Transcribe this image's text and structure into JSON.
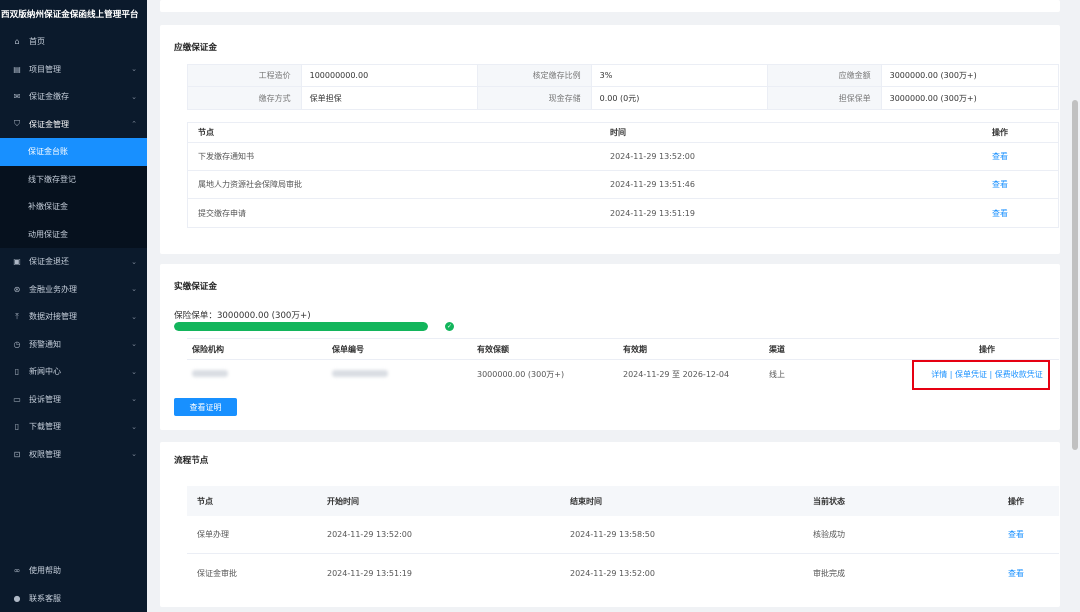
{
  "app": {
    "title": "西双版纳州保证金保函线上管理平台"
  },
  "sidebar": {
    "items": [
      {
        "label": "首页",
        "icon": "home-icon",
        "chevron": false
      },
      {
        "label": "项目管理",
        "icon": "project-icon",
        "chevron": true
      },
      {
        "label": "保证金缴存",
        "icon": "deposit-icon",
        "chevron": true
      },
      {
        "label": "保证金管理",
        "icon": "shield-icon",
        "chevron": true,
        "open": true
      }
    ],
    "submenu": [
      {
        "label": "保证金台账",
        "active": true
      },
      {
        "label": "线下缴存登记",
        "active": false
      },
      {
        "label": "补缴保证金",
        "active": false
      },
      {
        "label": "动用保证金",
        "active": false
      }
    ],
    "items_after": [
      {
        "label": "保证金退还",
        "icon": "refund-icon"
      },
      {
        "label": "金融业务办理",
        "icon": "finance-icon"
      },
      {
        "label": "数据对接管理",
        "icon": "upload-icon"
      },
      {
        "label": "预警通知",
        "icon": "clock-icon"
      },
      {
        "label": "新闻中心",
        "icon": "document-icon"
      },
      {
        "label": "投诉管理",
        "icon": "complaint-icon"
      },
      {
        "label": "下载管理",
        "icon": "download-icon"
      },
      {
        "label": "权限管理",
        "icon": "lock-icon"
      }
    ],
    "bottom": [
      {
        "label": "使用帮助",
        "icon": "link-icon"
      },
      {
        "label": "联系客服",
        "icon": "chat-icon"
      }
    ]
  },
  "due": {
    "title": "应缴保证金",
    "kv": [
      [
        {
          "label": "工程造价",
          "value": "100000000.00"
        },
        {
          "label": "核定缴存比例",
          "value": "3%"
        },
        {
          "label": "应缴金额",
          "value": "3000000.00 (300万+)"
        }
      ],
      [
        {
          "label": "缴存方式",
          "value": "保单担保"
        },
        {
          "label": "现金存储",
          "value": "0.00 (0元)"
        },
        {
          "label": "担保保单",
          "value": "3000000.00 (300万+)"
        }
      ]
    ],
    "nodes_header": {
      "node": "节点",
      "time": "时间",
      "action": "操作"
    },
    "nodes": [
      {
        "node": "下发缴存通知书",
        "time": "2024-11-29 13:52:00",
        "action": "查看"
      },
      {
        "node": "属地人力资源社会保障局审批",
        "time": "2024-11-29 13:51:46",
        "action": "查看"
      },
      {
        "node": "提交缴存申请",
        "time": "2024-11-29 13:51:19",
        "action": "查看"
      }
    ]
  },
  "paid": {
    "title": "实缴保证金",
    "progress_label": "保险保单：3000000.00 (300万+)",
    "progress": 1.0,
    "header": {
      "org": "保险机构",
      "no": "保单编号",
      "amount": "有效保额",
      "period": "有效期",
      "channel": "渠道",
      "action": "操作"
    },
    "rows": [
      {
        "amount": "3000000.00 (300万+)",
        "period": "2024-11-29 至 2026-12-04",
        "channel": "线上",
        "actions": [
          "详情",
          "保单凭证",
          "保费收款凭证"
        ],
        "sep": "|"
      }
    ],
    "view_cert_button": "查看证明"
  },
  "flow": {
    "title": "流程节点",
    "header": {
      "node": "节点",
      "start": "开始时间",
      "end": "结束时间",
      "status": "当前状态",
      "action": "操作"
    },
    "rows": [
      {
        "node": "保单办理",
        "start": "2024-11-29 13:52:00",
        "end": "2024-11-29 13:58:50",
        "status": "核验成功",
        "action": "查看"
      },
      {
        "node": "保证金审批",
        "start": "2024-11-29 13:51:19",
        "end": "2024-11-29 13:52:00",
        "status": "审批完成",
        "action": "查看"
      }
    ]
  },
  "colors": {
    "primary": "#1890ff",
    "success": "#13b55c",
    "sidebar_bg": "#0b1a2c",
    "highlight": "#e60012"
  }
}
